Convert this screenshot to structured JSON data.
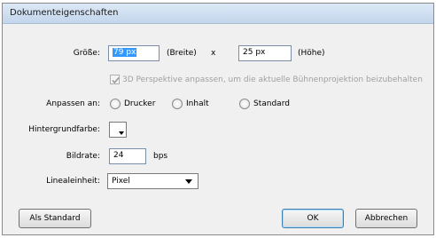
{
  "window": {
    "title": "Dokumenteigenschaften"
  },
  "size": {
    "label": "Größe:",
    "width_value": "79 px",
    "width_label": "(Breite)",
    "separator": "x",
    "height_value": "25 px",
    "height_label": "(Höhe)"
  },
  "perspective_checkbox": {
    "label": "3D Perspektive anpassen, um die aktuelle Bühnenprojektion beizubehalten",
    "checked": true,
    "enabled": false
  },
  "fit": {
    "label": "Anpassen an:",
    "options": [
      "Drucker",
      "Inhalt",
      "Standard"
    ]
  },
  "background": {
    "label": "Hintergrundfarbe:",
    "color": "#ffffff"
  },
  "framerate": {
    "label": "Bildrate:",
    "value": "24",
    "unit": "bps"
  },
  "ruler_units": {
    "label": "Linealeinheit:",
    "selected": "Pixel"
  },
  "buttons": {
    "make_default": "Als Standard",
    "ok": "OK",
    "cancel": "Abbrechen"
  },
  "colors": {
    "selection_highlight": "#3399ff",
    "default_button_border": "#3c7fb1",
    "dialog_background": "#f0f0f0"
  }
}
